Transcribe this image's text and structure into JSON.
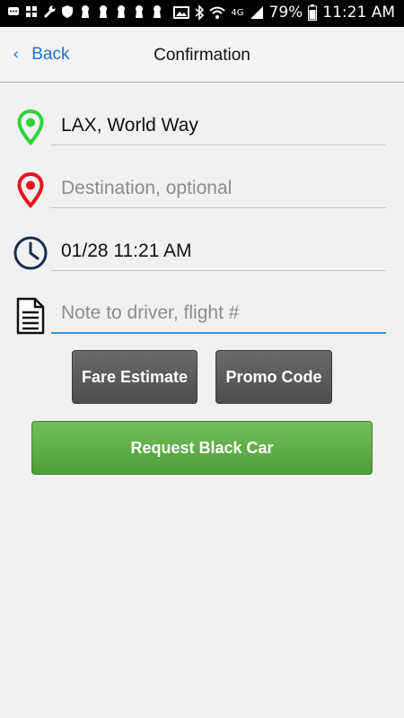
{
  "status_bar": {
    "network": "4G",
    "battery": "79%",
    "time": "11:21 AM"
  },
  "nav": {
    "back_label": "Back",
    "title": "Confirmation"
  },
  "form": {
    "pickup": {
      "value": "LAX, World Way",
      "icon": "green-location-pin-icon"
    },
    "destination": {
      "value": "",
      "placeholder": "Destination, optional",
      "icon": "red-location-pin-icon"
    },
    "datetime": {
      "value": "01/28 11:21 AM",
      "icon": "clock-icon"
    },
    "note": {
      "value": "",
      "placeholder": "Note to driver, flight #",
      "icon": "note-document-icon"
    }
  },
  "buttons": {
    "fare_estimate": "Fare Estimate",
    "promo_code": "Promo Code",
    "request": "Request Black Car"
  },
  "colors": {
    "pickup_pin": "#2fd43b",
    "destination_pin": "#e8141d",
    "link_blue": "#1a73d9",
    "request_green": "#5fb047",
    "gray_button": "#5a5a5a"
  }
}
